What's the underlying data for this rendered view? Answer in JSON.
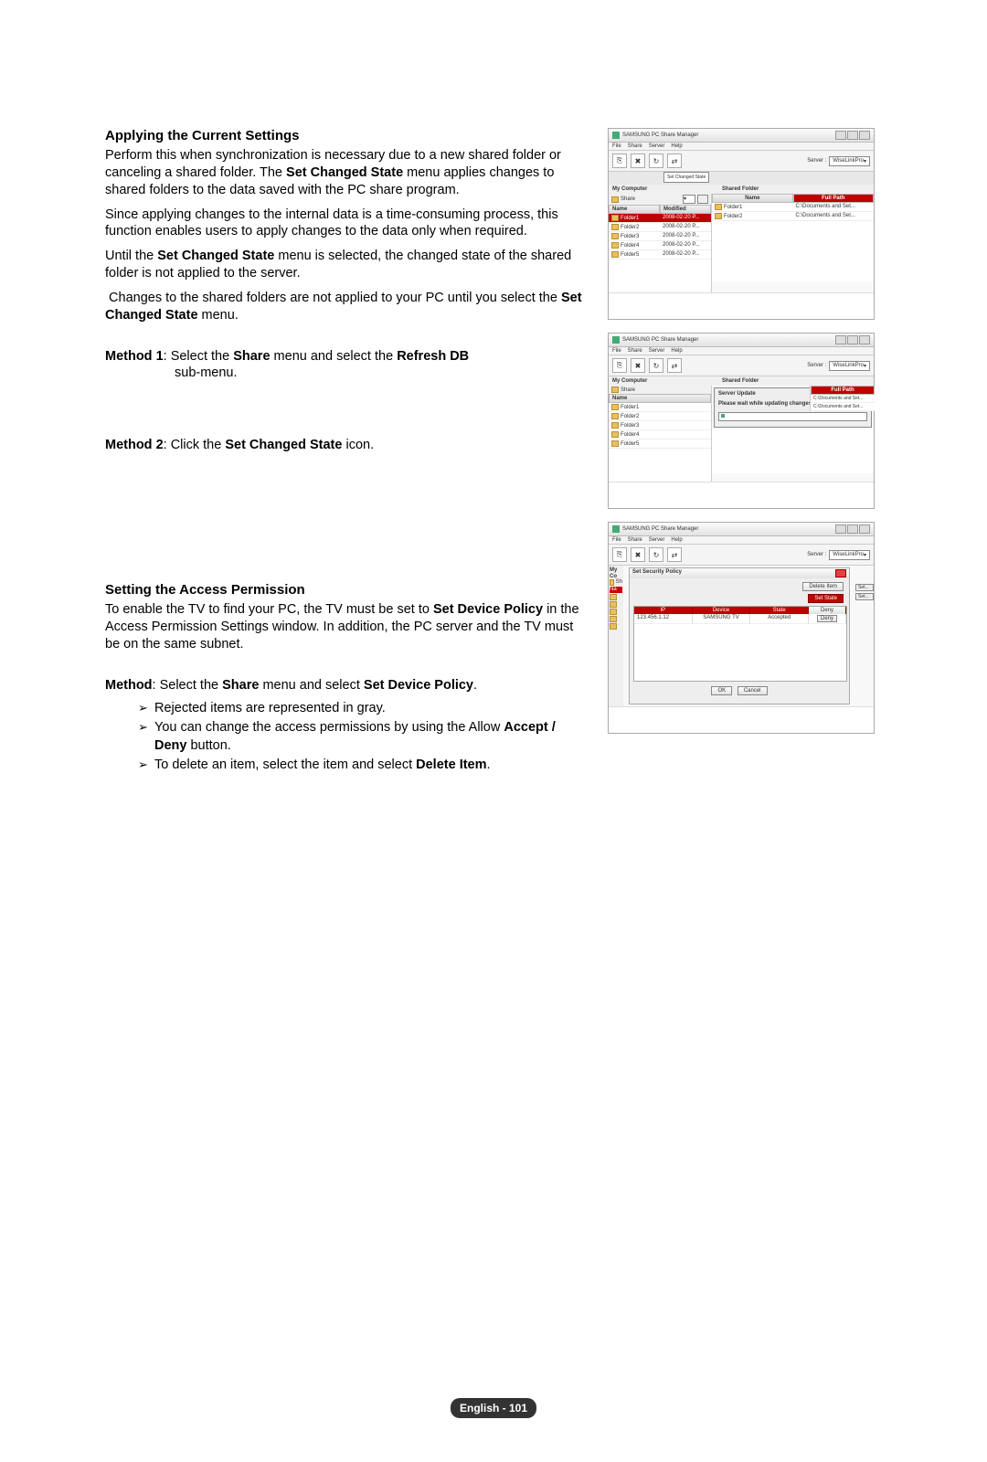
{
  "section1": {
    "heading": "Applying the Current Settings",
    "p1a": "Perform this when synchronization is necessary due to a new shared folder or canceling a shared folder. The ",
    "p1b": "Set Changed State",
    "p1c": " menu applies changes to shared folders to the data saved with the PC share program.",
    "p2": "Since applying changes to the internal data is a time-consuming process, this function enables users to apply changes to the data only when required.",
    "p3": "Until the Set Changed State menu is selected, the changed state of the shared folder is not applied to the server.",
    "p4": " Changes to the shared folders are not applied to your PC until you select the Set Changed State menu.",
    "m1_label": "Method 1",
    "m1_a": ": Select the ",
    "m1_b": "Share",
    "m1_c": " menu and select the ",
    "m1_d": "Refresh DB",
    "m1_e": "sub-menu.",
    "m2_label": "Method 2",
    "m2_a": ": Click the ",
    "m2_b": "Set Changed State",
    "m2_c": " icon."
  },
  "section2": {
    "heading": "Setting the Access Permission",
    "p1a": "To enable the TV to find your PC, the TV must be set to ",
    "p1b": "Set Device Policy",
    "p1c": " in the Access Permission Settings window. In addition, the PC server and the TV must be on the same subnet.",
    "m_label": "Method",
    "m_a": ": Select the ",
    "m_b": "Share",
    "m_c": " menu and select ",
    "m_d": "Set Device Policy",
    "m_e": ".",
    "b1": "Rejected items are represented in gray.",
    "b2a": "You can change the access permissions by using the Allow ",
    "b2b": "Accept / Deny",
    "b2c": " button.",
    "b3a": "To delete an item, select the item and select ",
    "b3b": "Delete Item",
    "b3c": "."
  },
  "screenshots": {
    "app_title": "SAMSUNG PC Share Manager",
    "menus": [
      "File",
      "Share",
      "Server",
      "Help"
    ],
    "server_label": "Server :",
    "server_value": "WiseLinkPro",
    "set_changed_chip": "Set Changed State",
    "my_computer": "My Computer",
    "shared_folder": "Shared Folder",
    "share_label": "Share",
    "name_col": "Name",
    "modified_col": "Modified",
    "fullpath_col": "Full Path",
    "left_folders": [
      {
        "name": "Folder1",
        "date": "2008-02-20 P..."
      },
      {
        "name": "Folder2",
        "date": "2008-02-20 P..."
      },
      {
        "name": "Folder3",
        "date": "2008-02-20 P..."
      },
      {
        "name": "Folder4",
        "date": "2008-02-20 P..."
      },
      {
        "name": "Folder5",
        "date": "2008-02-20 P..."
      }
    ],
    "right_shared": [
      {
        "name": "Folder1",
        "path": "C:\\Documents and Set..."
      },
      {
        "name": "Folder2",
        "path": "C:\\Documents and Set..."
      }
    ],
    "server_update": "Server Update",
    "update_msg": "Please wait while updating changes on PC",
    "sec_policy_title": "Set Security Policy",
    "delete_item": "Delete Item",
    "set_state": "Set State",
    "deny": "Deny",
    "ip_col": "IP",
    "device_col": "Device",
    "state_col": "State",
    "ip": "123.456.1.12",
    "device": "SAMSUNG TV",
    "state": "Accepted",
    "ok": "OK",
    "cancel": "Cancel",
    "set_mini": "Set..."
  },
  "footer": "English - 101"
}
